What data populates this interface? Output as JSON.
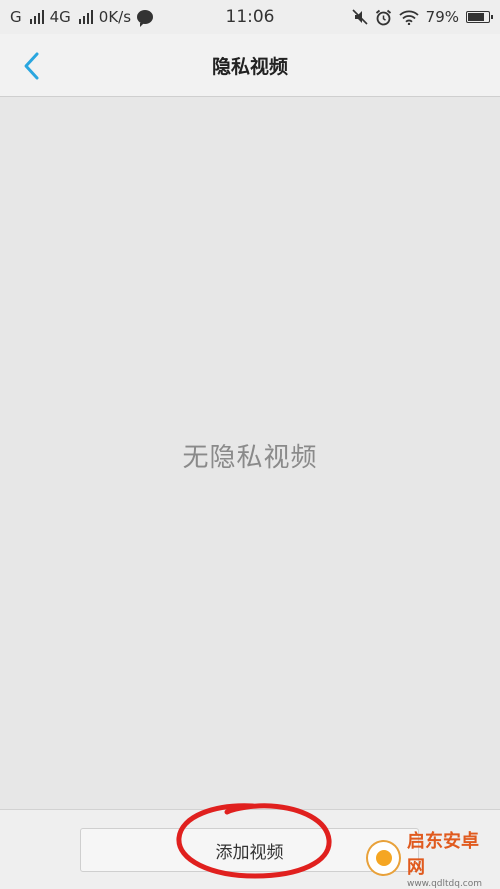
{
  "status_bar": {
    "signal_1": "G",
    "signal_2": "4G",
    "speed": "0K/s",
    "time": "11:06",
    "battery": "79%",
    "battery_level": 0.79
  },
  "header": {
    "title": "隐私视频"
  },
  "main": {
    "empty_message": "无隐私视频"
  },
  "footer": {
    "add_label": "添加视频"
  },
  "watermark": {
    "title": "启东安卓网",
    "url": "www.qdltdq.com"
  },
  "colors": {
    "accent": "#2aa6df",
    "annotation": "#e0201e",
    "background": "#e7e7e7"
  },
  "icons": [
    "back-chevron-icon",
    "signal-icon",
    "message-icon",
    "mute-icon",
    "alarm-icon",
    "wifi-icon",
    "battery-icon"
  ]
}
